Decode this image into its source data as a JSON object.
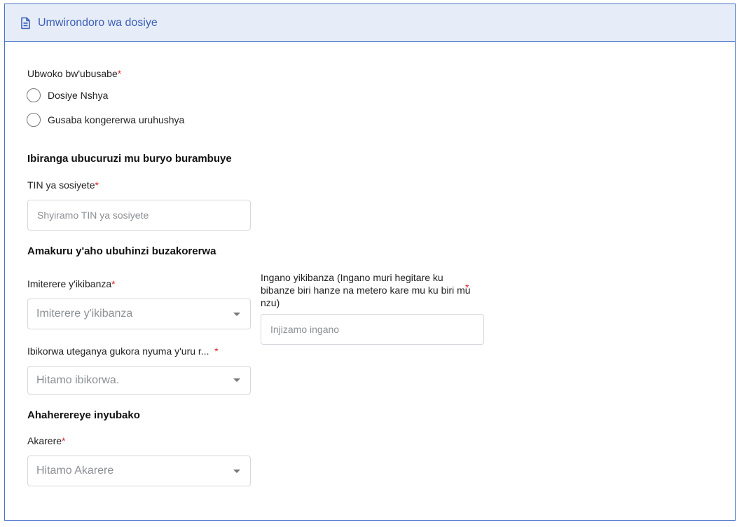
{
  "header": {
    "title": "Umwirondoro wa dosiye"
  },
  "request_type": {
    "label": "Ubwoko bw'ubusabe",
    "required": "*",
    "options": [
      {
        "label": "Dosiye Nshya"
      },
      {
        "label": "Gusaba kongererwa uruhushya"
      }
    ]
  },
  "business": {
    "section_title": "Ibiranga ubucuruzi mu buryo burambuye",
    "tin": {
      "label": "TIN ya sosiyete",
      "required": "*",
      "placeholder": "Shyiramo TIN ya sosiyete"
    }
  },
  "location": {
    "section_title": "Amakuru y'aho ubuhinzi buzakorerwa",
    "plot_type": {
      "label": "Imiterere y'ikibanza",
      "required": "*",
      "placeholder": "Imiterere y'ikibanza"
    },
    "plot_size": {
      "label": "Ingano yikibanza (Ingano muri hegitare ku bibanze biri hanze na metero kare mu ku biri mu nzu)",
      "required": "*",
      "placeholder": "Injizamo ingano"
    },
    "products": {
      "label": "Ibikorwa uteganya gukora nyuma y'uru r...",
      "required": "*",
      "placeholder": "Hitamo ibikorwa."
    }
  },
  "building": {
    "section_title": "Ahaherereye inyubako",
    "district": {
      "label": "Akarere",
      "required": "*",
      "placeholder": "Hitamo Akarere"
    }
  }
}
